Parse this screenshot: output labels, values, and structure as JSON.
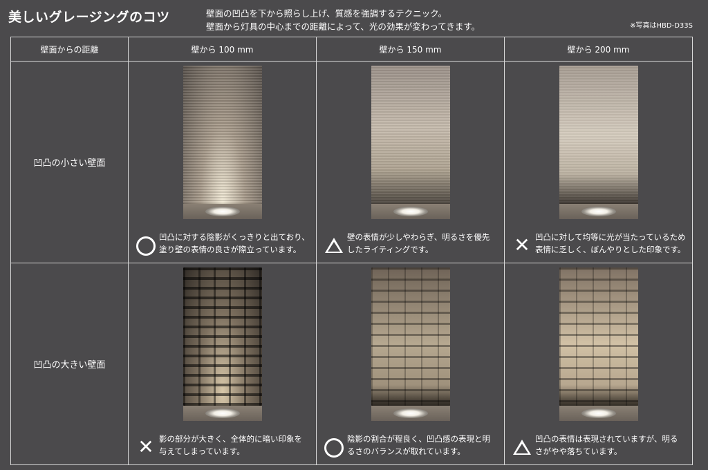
{
  "header": {
    "title": "美しいグレージングのコツ",
    "desc_line1": "壁面の凹凸を下から照らし上げ、質感を強調するテクニック。",
    "desc_line2": "壁面から灯具の中心までの距離によって、光の効果が変わってきます。",
    "note": "※写真はHBD-D33S"
  },
  "table": {
    "corner_label": "壁面からの距離",
    "columns": [
      "壁から 100 mm",
      "壁から 150 mm",
      "壁から 200 mm"
    ],
    "rows": [
      {
        "label": "凹凸の小さい壁面",
        "cells": [
          {
            "symbol": "circle",
            "line1": "凹凸に対する陰影がくっきりと出ており、",
            "line2": "塗り壁の表情の良さが際立っています。"
          },
          {
            "symbol": "triangle",
            "line1": "壁の表情が少しやわらぎ、明るさを優先",
            "line2": "したライティングです。"
          },
          {
            "symbol": "cross",
            "line1": "凹凸に対して均等に光が当たっているため",
            "line2": "表情に乏しく、ぼんやりとした印象です。"
          }
        ]
      },
      {
        "label": "凹凸の大きい壁面",
        "cells": [
          {
            "symbol": "cross",
            "line1": "影の部分が大きく、全体的に暗い印象を",
            "line2": "与えてしまっています。"
          },
          {
            "symbol": "circle",
            "line1": "陰影の割合が程良く、凹凸感の表現と明",
            "line2": "るさのバランスが取れています。"
          },
          {
            "symbol": "triangle",
            "line1": "凹凸の表情は表現されていますが、明る",
            "line2": "さがやや落ちています。"
          }
        ]
      }
    ]
  }
}
